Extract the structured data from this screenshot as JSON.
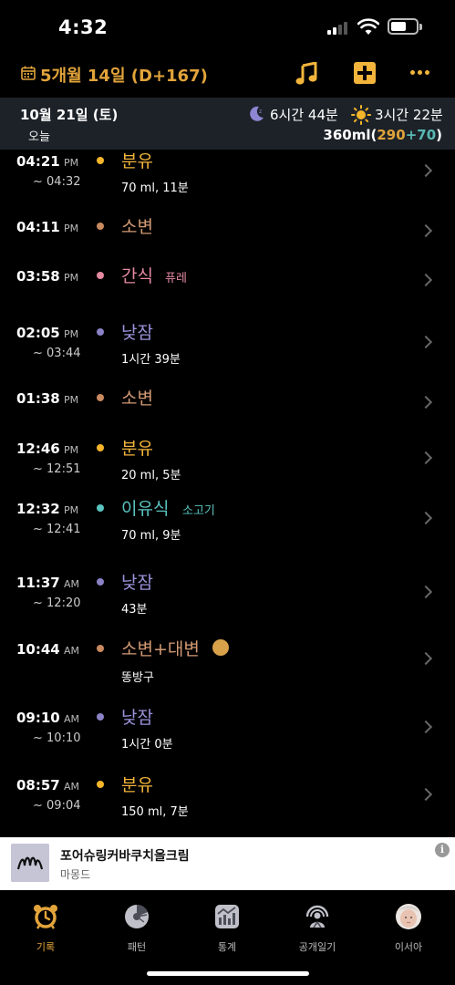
{
  "status_bar": {
    "time": "4:32"
  },
  "header": {
    "title": "5개월 14일 (D+167)"
  },
  "summary": {
    "date": "10월 21일 (토)",
    "today": "오늘",
    "night_sleep": "6시간 44분",
    "day_sleep": "3시간 22분",
    "total_ml": "360ml",
    "paren_open": "(",
    "formula_ml": "290",
    "plus": "+",
    "food_ml": "70",
    "paren_close": ")"
  },
  "colors": {
    "accent": "#e2a43a",
    "feeding_dot": "#f5b52b",
    "urine_dot": "#c98a60",
    "snack_dot": "#e48aa1",
    "sleep_dot": "#8b82c6",
    "babyfood_dot": "#5ac4c1"
  },
  "entries": [
    {
      "time": "04:21",
      "ampm": "PM",
      "end": "~ 04:32",
      "title": "분유",
      "sub": "",
      "detail": "70 ml, 11분",
      "type": "feeding"
    },
    {
      "time": "04:11",
      "ampm": "PM",
      "end": "",
      "title": "소변",
      "sub": "",
      "detail": "",
      "type": "urine"
    },
    {
      "time": "03:58",
      "ampm": "PM",
      "end": "",
      "title": "간식",
      "sub": "퓨레",
      "detail": "",
      "type": "snack"
    },
    {
      "time": "02:05",
      "ampm": "PM",
      "end": "~ 03:44",
      "title": "낮잠",
      "sub": "",
      "detail": "1시간 39분",
      "type": "sleep"
    },
    {
      "time": "01:38",
      "ampm": "PM",
      "end": "",
      "title": "소변",
      "sub": "",
      "detail": "",
      "type": "urine"
    },
    {
      "time": "12:46",
      "ampm": "PM",
      "end": "~ 12:51",
      "title": "분유",
      "sub": "",
      "detail": "20 ml, 5분",
      "type": "feeding"
    },
    {
      "time": "12:32",
      "ampm": "PM",
      "end": "~ 12:41",
      "title": "이유식",
      "sub": "소고기",
      "detail": "70 ml, 9분",
      "type": "babyfood"
    },
    {
      "time": "11:37",
      "ampm": "AM",
      "end": "~ 12:20",
      "title": "낮잠",
      "sub": "",
      "detail": "43분",
      "type": "sleep"
    },
    {
      "time": "10:44",
      "ampm": "AM",
      "end": "",
      "title": "소변+대변",
      "sub": "",
      "detail": "똥방구",
      "type": "diaper"
    },
    {
      "time": "09:10",
      "ampm": "AM",
      "end": "~ 10:10",
      "title": "낮잠",
      "sub": "",
      "detail": "1시간 0분",
      "type": "sleep"
    },
    {
      "time": "08:57",
      "ampm": "AM",
      "end": "~ 09:04",
      "title": "분유",
      "sub": "",
      "detail": "150 ml, 7분",
      "type": "feeding"
    }
  ],
  "ad": {
    "title": "포어슈링커바쿠치올크림",
    "subtitle": "마몽드",
    "info": "i"
  },
  "tabs": [
    {
      "label": "기록",
      "icon": "alarm-clock-icon",
      "active": true
    },
    {
      "label": "패턴",
      "icon": "pattern-chart-icon",
      "active": false
    },
    {
      "label": "통계",
      "icon": "statistics-icon",
      "active": false
    },
    {
      "label": "공개일기",
      "icon": "public-diary-icon",
      "active": false
    },
    {
      "label": "이서아",
      "icon": "baby-profile-avatar",
      "active": false
    }
  ]
}
